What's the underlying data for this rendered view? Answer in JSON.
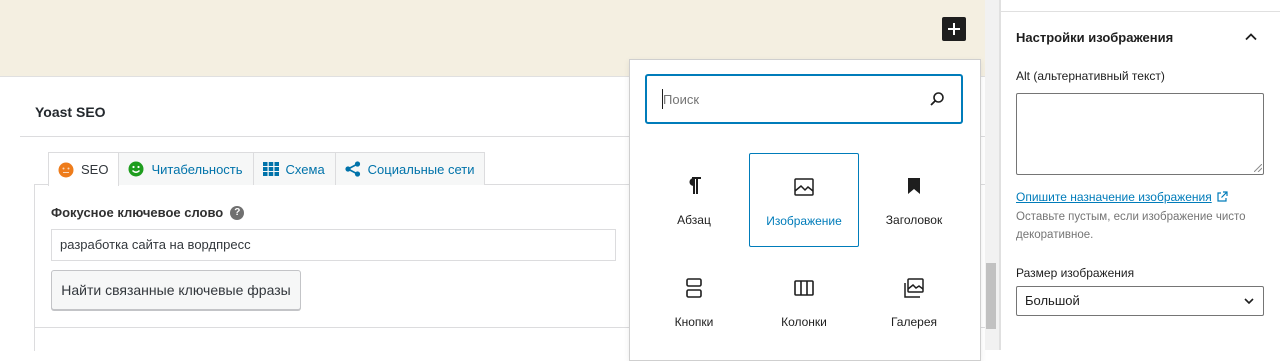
{
  "yoast": {
    "title": "Yoast SEO",
    "tabs": [
      {
        "label": "SEO"
      },
      {
        "label": "Читабельность"
      },
      {
        "label": "Схема"
      },
      {
        "label": "Социальные сети"
      }
    ],
    "focus_keyword_label": "Фокусное ключевое слово",
    "help_icon": "?",
    "focus_keyword_value": "разработка сайта на вордпресс",
    "related_button": "Найти связанные ключевые фразы"
  },
  "inserter": {
    "search_placeholder": "Поиск",
    "blocks": [
      {
        "label": "Абзац",
        "icon": "paragraph-icon"
      },
      {
        "label": "Изображение",
        "icon": "image-icon"
      },
      {
        "label": "Заголовок",
        "icon": "bookmark-icon"
      },
      {
        "label": "Кнопки",
        "icon": "buttons-icon"
      },
      {
        "label": "Колонки",
        "icon": "columns-icon"
      },
      {
        "label": "Галерея",
        "icon": "gallery-icon"
      }
    ]
  },
  "sidebar": {
    "title": "Настройки изображения",
    "alt_label": "Alt (альтернативный текст)",
    "alt_value": "",
    "alt_link": "Опишите назначение изображения",
    "alt_help": "Оставьте пустым, если изображение чисто декоративное.",
    "size_label": "Размер изображения",
    "size_value": "Большой"
  },
  "colors": {
    "accent": "#007cba",
    "canvas_bg": "#f4efe1",
    "dark": "#1e1e1e"
  }
}
